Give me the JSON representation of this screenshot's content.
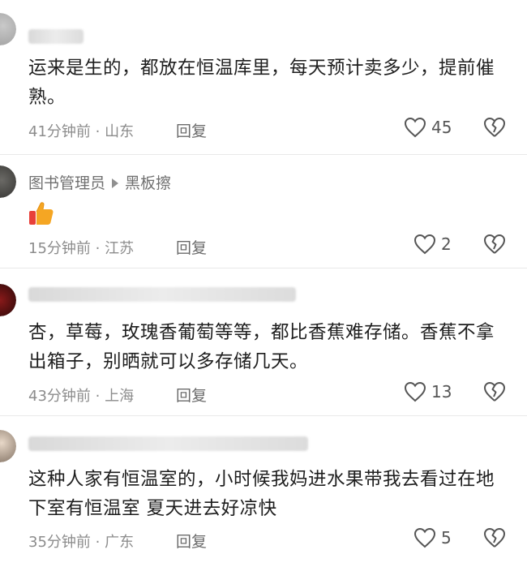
{
  "comments": [
    {
      "text": "运来是生的，都放在恒温库里，每天预计卖多少，提前催熟。",
      "meta": "41分钟前 · 山东",
      "reply": "回复",
      "likes": "45"
    },
    {
      "username": "图书管理员",
      "reply_to": "黑板擦",
      "emoji": "thumbs-up-icon",
      "meta": "15分钟前 · 江苏",
      "reply": "回复",
      "likes": "2"
    },
    {
      "text": "杏，草莓，玫瑰香葡萄等等，都比香蕉难存储。香蕉不拿出箱子，别晒就可以多存储几天。",
      "meta": "43分钟前 · 上海",
      "reply": "回复",
      "likes": "13"
    },
    {
      "text": "这种人家有恒温室的，小时候我妈进水果带我去看过在地下室有恒温室 夏天进去好凉快",
      "meta": "35分钟前 · 广东",
      "reply": "回复",
      "likes": "5"
    }
  ],
  "colors": {
    "text": "#1e1e1e",
    "meta": "#8c8c8c",
    "icon": "#555555"
  }
}
